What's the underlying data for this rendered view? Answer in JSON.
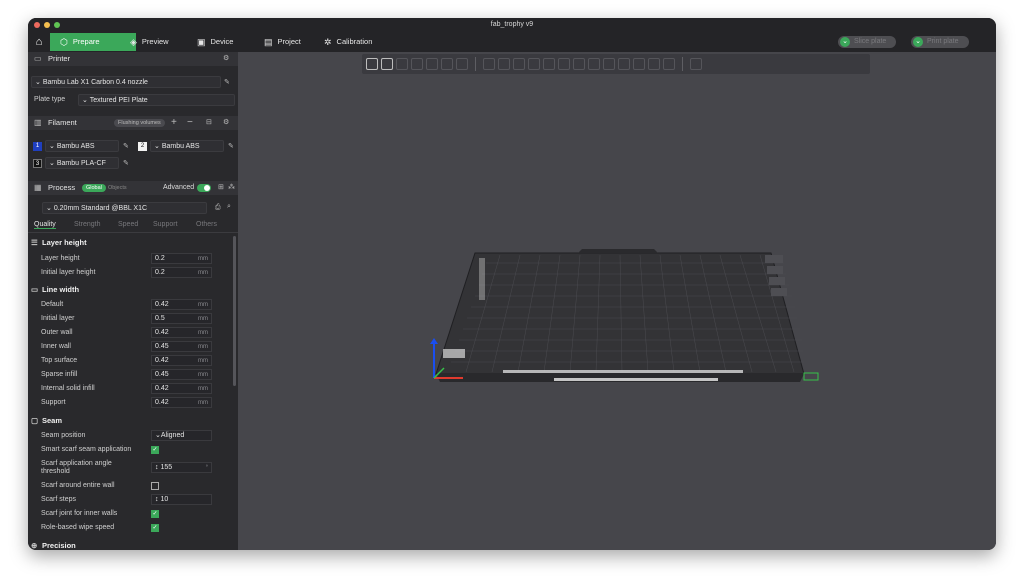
{
  "window": {
    "title": "fab_trophy v9"
  },
  "colors": {
    "accent": "#3ba85a",
    "dot_red": "#ed6a5e",
    "dot_yellow": "#f4bf4f",
    "dot_green": "#61c554"
  },
  "nav": {
    "home_icon": "home-icon",
    "tabs": [
      {
        "label": "Prepare",
        "icon": "cube-icon"
      },
      {
        "label": "Preview",
        "icon": "layers-icon"
      },
      {
        "label": "Device",
        "icon": "device-icon"
      },
      {
        "label": "Project",
        "icon": "project-icon"
      },
      {
        "label": "Calibration",
        "icon": "gear-icon"
      }
    ],
    "slice_plate": "Slice plate",
    "print_plate": "Print plate"
  },
  "printer": {
    "header": "Printer",
    "model": "Bambu Lab X1 Carbon 0.4 nozzle",
    "plate_type_label": "Plate type",
    "plate_type": "Textured PEI Plate"
  },
  "filament": {
    "header": "Filament",
    "flushing": "Flushing volumes",
    "plus": "+",
    "minus": "−",
    "slots": [
      {
        "num": "1",
        "name": "Bambu ABS",
        "color": "#1f3fbf"
      },
      {
        "num": "2",
        "name": "Bambu ABS",
        "color": "#f2f2f2"
      },
      {
        "num": "3",
        "name": "Bambu PLA-CF",
        "color": "#111111"
      }
    ]
  },
  "process": {
    "header": "Process",
    "global": "Global",
    "objects": "Objects",
    "advanced": "Advanced",
    "preset": "0.20mm Standard @BBL X1C",
    "tabs": [
      "Quality",
      "Strength",
      "Speed",
      "Support",
      "Others"
    ]
  },
  "layer_height": {
    "title": "Layer height",
    "rows": [
      {
        "label": "Layer height",
        "value": "0.2",
        "unit": "mm"
      },
      {
        "label": "Initial layer height",
        "value": "0.2",
        "unit": "mm"
      }
    ]
  },
  "line_width": {
    "title": "Line width",
    "rows": [
      {
        "label": "Default",
        "value": "0.42",
        "unit": "mm"
      },
      {
        "label": "Initial layer",
        "value": "0.5",
        "unit": "mm"
      },
      {
        "label": "Outer wall",
        "value": "0.42",
        "unit": "mm"
      },
      {
        "label": "Inner wall",
        "value": "0.45",
        "unit": "mm"
      },
      {
        "label": "Top surface",
        "value": "0.42",
        "unit": "mm"
      },
      {
        "label": "Sparse infill",
        "value": "0.45",
        "unit": "mm"
      },
      {
        "label": "Internal solid infill",
        "value": "0.42",
        "unit": "mm"
      },
      {
        "label": "Support",
        "value": "0.42",
        "unit": "mm"
      }
    ]
  },
  "seam": {
    "title": "Seam",
    "position_label": "Seam position",
    "position_value": "Aligned",
    "smart_scarf": "Smart scarf seam application",
    "angle_label_1": "Scarf application angle",
    "angle_label_2": "threshold",
    "angle_value": "155",
    "around_wall": "Scarf around entire wall",
    "steps_label": "Scarf steps",
    "steps_value": "10",
    "inner_walls": "Scarf joint for inner walls",
    "wipe_speed": "Role-based wipe speed"
  },
  "precision": {
    "title": "Precision"
  }
}
